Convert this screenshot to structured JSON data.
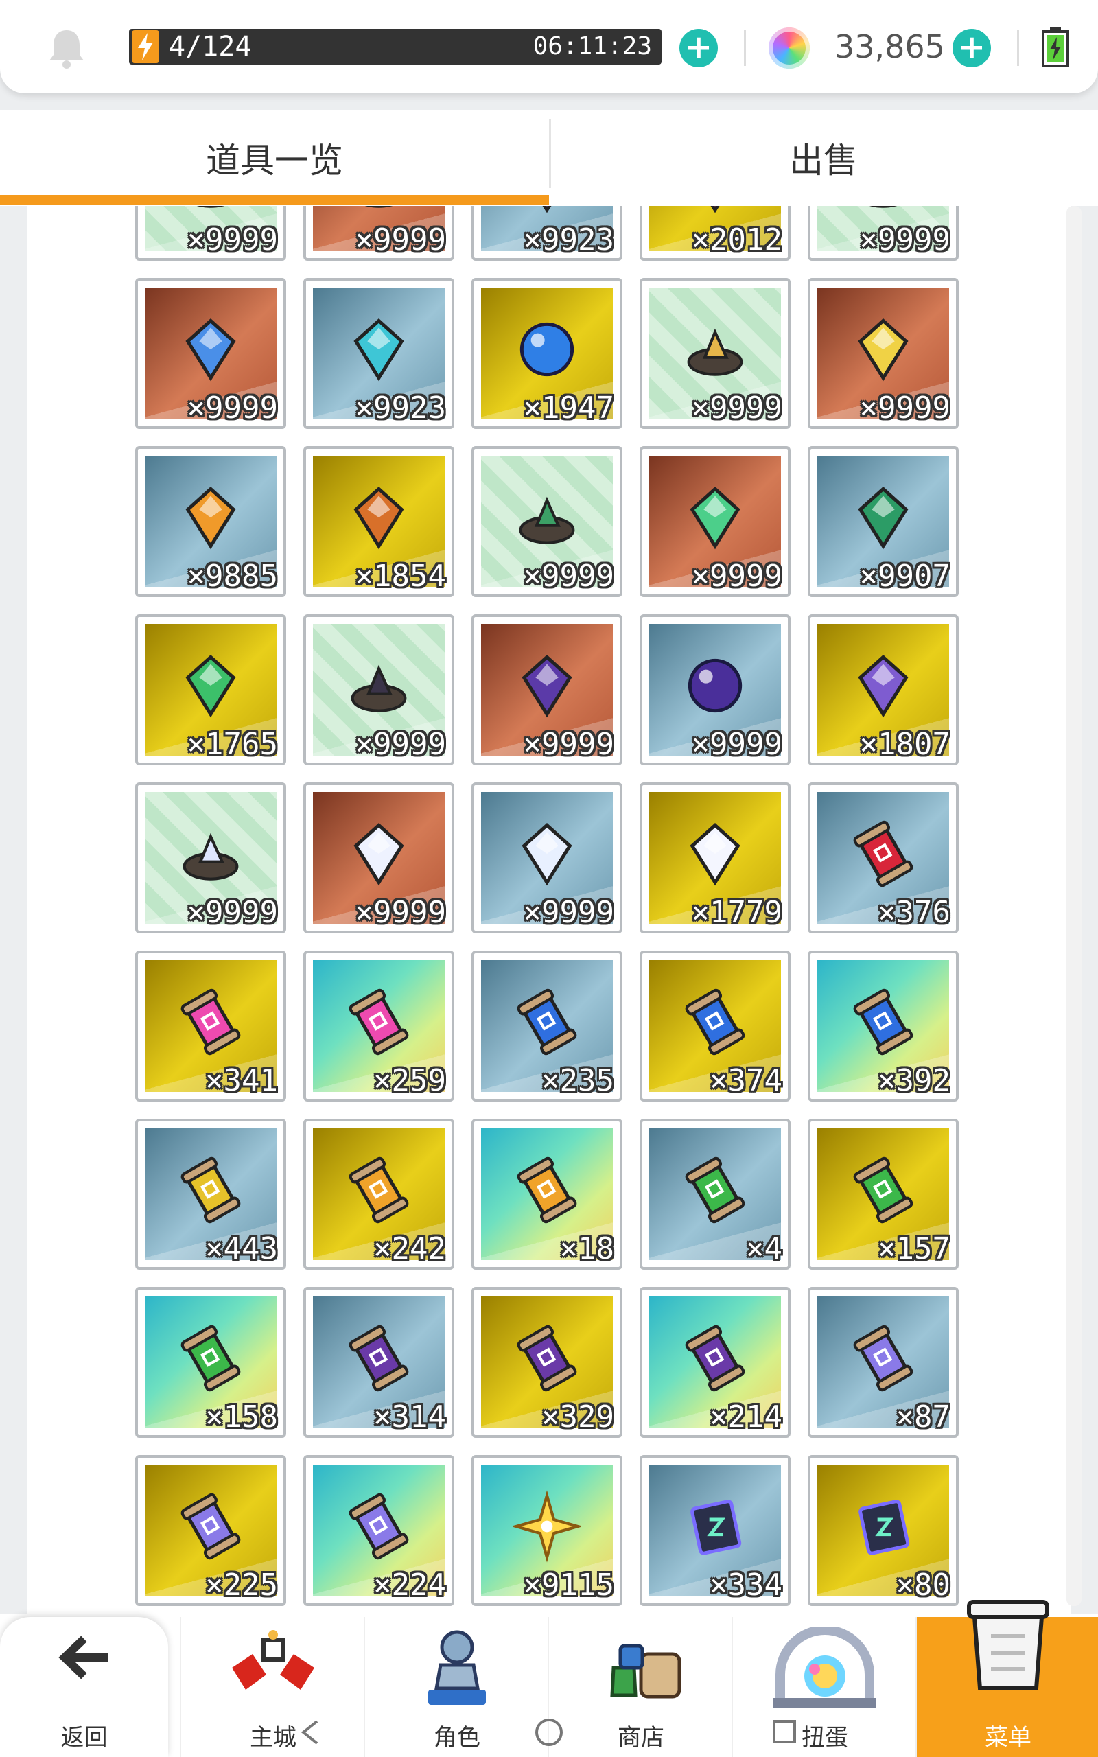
{
  "status": {
    "stamina": "4/124",
    "timer": "06:11:23",
    "currency": "33,865"
  },
  "tabs": [
    {
      "label": "道具一览",
      "active": true
    },
    {
      "label": "出售",
      "active": false
    }
  ],
  "colors": {
    "accent": "#f59a1c",
    "plus": "#20bfb0"
  },
  "items": [
    {
      "qty": "×9999",
      "bg": "mint",
      "icon": "ore-icon"
    },
    {
      "qty": "×9999",
      "bg": "copper",
      "icon": "ore-icon"
    },
    {
      "qty": "×9923",
      "bg": "steel",
      "icon": "gem-icon"
    },
    {
      "qty": "×2012",
      "bg": "gold",
      "icon": "crystal-icon"
    },
    {
      "qty": "×9999",
      "bg": "mint",
      "icon": "ore-icon"
    },
    {
      "qty": "×9999",
      "bg": "copper",
      "icon": "blue-gem-icon"
    },
    {
      "qty": "×9923",
      "bg": "steel",
      "icon": "aqua-crystal-icon"
    },
    {
      "qty": "×1947",
      "bg": "gold",
      "icon": "blue-orb-icon"
    },
    {
      "qty": "×9999",
      "bg": "mint",
      "icon": "gold-ore-icon"
    },
    {
      "qty": "×9999",
      "bg": "copper",
      "icon": "yellow-gem-icon"
    },
    {
      "qty": "×9885",
      "bg": "steel",
      "icon": "amber-gem-icon"
    },
    {
      "qty": "×1854",
      "bg": "gold",
      "icon": "winged-crystal-icon"
    },
    {
      "qty": "×9999",
      "bg": "mint",
      "icon": "green-ore-icon"
    },
    {
      "qty": "×9999",
      "bg": "copper",
      "icon": "green-crystal-icon"
    },
    {
      "qty": "×9907",
      "bg": "steel",
      "icon": "emerald-icon"
    },
    {
      "qty": "×1765",
      "bg": "gold",
      "icon": "green-relic-icon"
    },
    {
      "qty": "×9999",
      "bg": "mint",
      "icon": "dark-ore-icon"
    },
    {
      "qty": "×9999",
      "bg": "copper",
      "icon": "purple-gem-icon"
    },
    {
      "qty": "×9999",
      "bg": "steel",
      "icon": "purple-orb-icon"
    },
    {
      "qty": "×1807",
      "bg": "gold",
      "icon": "winged-purple-gem-icon"
    },
    {
      "qty": "×9999",
      "bg": "mint",
      "icon": "white-ore-icon"
    },
    {
      "qty": "×9999",
      "bg": "copper",
      "icon": "white-crystal-icon"
    },
    {
      "qty": "×9999",
      "bg": "steel",
      "icon": "diamond-icon"
    },
    {
      "qty": "×1779",
      "bg": "gold",
      "icon": "winged-white-crystal-icon"
    },
    {
      "qty": "×376",
      "bg": "steel",
      "icon": "red-scroll-icon"
    },
    {
      "qty": "×341",
      "bg": "gold",
      "icon": "pink-scroll-icon"
    },
    {
      "qty": "×259",
      "bg": "rainbow",
      "icon": "pink-scroll-icon"
    },
    {
      "qty": "×235",
      "bg": "steel",
      "icon": "blue-scroll-icon"
    },
    {
      "qty": "×374",
      "bg": "gold",
      "icon": "blue-scroll-icon"
    },
    {
      "qty": "×392",
      "bg": "rainbow",
      "icon": "blue-scroll-icon"
    },
    {
      "qty": "×443",
      "bg": "steel",
      "icon": "yellow-scroll-icon"
    },
    {
      "qty": "×242",
      "bg": "gold",
      "icon": "orange-scroll-icon"
    },
    {
      "qty": "×18",
      "bg": "rainbow",
      "icon": "orange-scroll-icon"
    },
    {
      "qty": "×4",
      "bg": "steel",
      "icon": "green-scroll-icon"
    },
    {
      "qty": "×157",
      "bg": "gold",
      "icon": "green-scroll-icon"
    },
    {
      "qty": "×158",
      "bg": "rainbow",
      "icon": "green-scroll-icon"
    },
    {
      "qty": "×314",
      "bg": "steel",
      "icon": "purple-scroll-icon"
    },
    {
      "qty": "×329",
      "bg": "gold",
      "icon": "purple-scroll-icon"
    },
    {
      "qty": "×214",
      "bg": "rainbow",
      "icon": "purple-scroll-icon"
    },
    {
      "qty": "×87",
      "bg": "steel",
      "icon": "violet-scroll-icon"
    },
    {
      "qty": "×225",
      "bg": "gold",
      "icon": "violet-scroll-icon"
    },
    {
      "qty": "×224",
      "bg": "rainbow",
      "icon": "violet-scroll-icon"
    },
    {
      "qty": "×9115",
      "bg": "rainbow",
      "icon": "star-icon"
    },
    {
      "qty": "×334",
      "bg": "steel",
      "icon": "rune-card-icon"
    },
    {
      "qty": "×80",
      "bg": "gold",
      "icon": "rune-card-icon"
    }
  ],
  "nav": {
    "back": "返回",
    "city": "主城",
    "character": "角色",
    "shop": "商店",
    "gacha": "扭蛋",
    "menu": "菜单"
  }
}
